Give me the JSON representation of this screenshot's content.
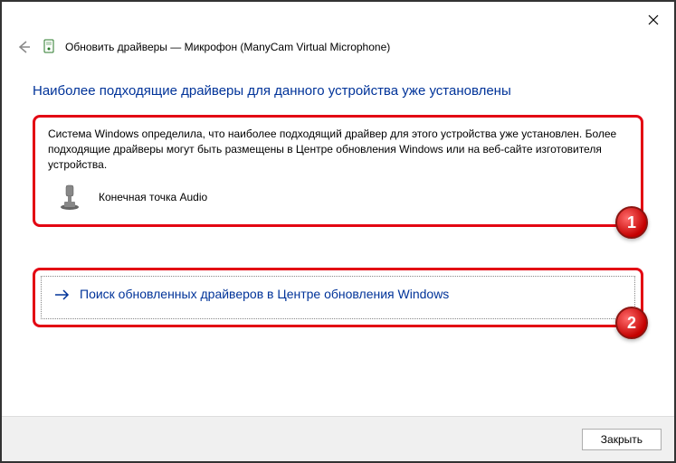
{
  "titlebar": {
    "close_tooltip": "Close"
  },
  "header": {
    "title": "Обновить драйверы — Микрофон (ManyCam Virtual Microphone)"
  },
  "content": {
    "heading": "Наиболее подходящие драйверы для данного устройства уже установлены",
    "info_text": "Система Windows определила, что наиболее подходящий драйвер для этого устройства уже установлен. Более подходящие драйверы могут быть размещены в Центре обновления Windows или на веб-сайте изготовителя устройства.",
    "device_name": "Конечная точка Audio",
    "link_text": "Поиск обновленных драйверов в Центре обновления Windows"
  },
  "badges": {
    "one": "1",
    "two": "2"
  },
  "footer": {
    "close_label": "Закрыть"
  }
}
